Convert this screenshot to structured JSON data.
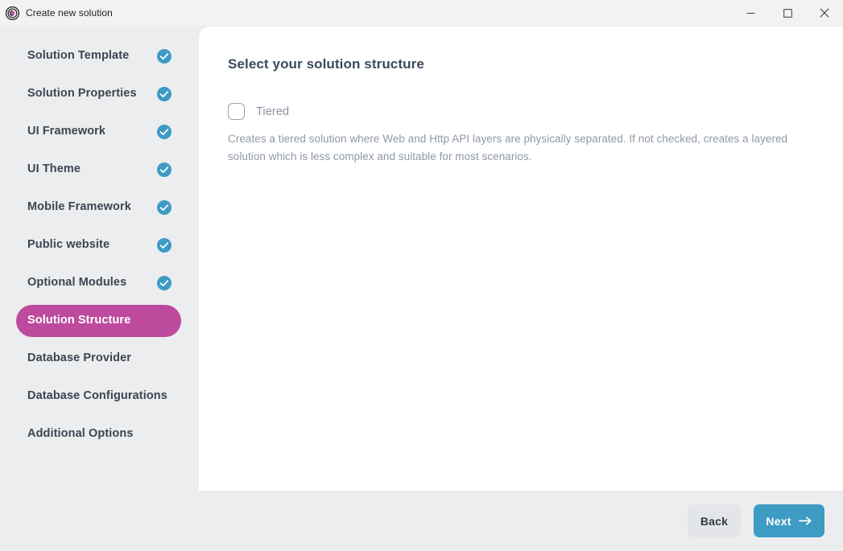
{
  "window": {
    "title": "Create new solution",
    "logo_icon": "abp-logo-icon",
    "controls": {
      "minimize_icon": "minimize-icon",
      "maximize_icon": "maximize-icon",
      "close_icon": "close-icon"
    }
  },
  "sidebar": {
    "items": [
      {
        "label": "Solution Template",
        "completed": true,
        "active": false,
        "icon": "check-circle-icon"
      },
      {
        "label": "Solution Properties",
        "completed": true,
        "active": false,
        "icon": "check-circle-icon"
      },
      {
        "label": "UI Framework",
        "completed": true,
        "active": false,
        "icon": "check-circle-icon"
      },
      {
        "label": "UI Theme",
        "completed": true,
        "active": false,
        "icon": "check-circle-icon"
      },
      {
        "label": "Mobile Framework",
        "completed": true,
        "active": false,
        "icon": "check-circle-icon"
      },
      {
        "label": "Public website",
        "completed": true,
        "active": false,
        "icon": "check-circle-icon"
      },
      {
        "label": "Optional Modules",
        "completed": true,
        "active": false,
        "icon": "check-circle-icon"
      },
      {
        "label": "Solution Structure",
        "completed": false,
        "active": true,
        "icon": ""
      },
      {
        "label": "Database Provider",
        "completed": false,
        "active": false,
        "icon": ""
      },
      {
        "label": "Database Configurations",
        "completed": false,
        "active": false,
        "icon": ""
      },
      {
        "label": "Additional Options",
        "completed": false,
        "active": false,
        "icon": ""
      }
    ]
  },
  "main": {
    "heading": "Select your solution structure",
    "checkbox": {
      "label": "Tiered",
      "checked": false
    },
    "description": "Creates a tiered solution where Web and Http API layers are physically separated. If not checked, creates a layered solution which is less complex and suitable for most scenarios."
  },
  "footer": {
    "back_label": "Back",
    "next_label": "Next",
    "next_arrow_icon": "arrow-right-icon"
  },
  "colors": {
    "accent_blue": "#3d9bc4",
    "active_magenta": "#bd4a9c",
    "background_gray": "#ecedef",
    "panel_white": "#ffffff",
    "titlebar_gray": "#f2f2f2",
    "text_dark": "#3b4652",
    "text_muted": "#9099a3"
  },
  "behind_window": {
    "fragment_text": "─ ─ ─"
  }
}
